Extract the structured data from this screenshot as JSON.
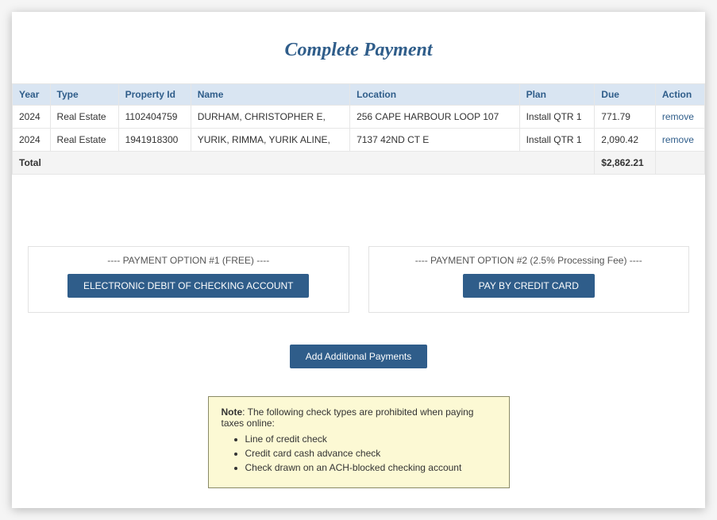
{
  "page": {
    "title": "Complete Payment"
  },
  "table": {
    "headers": {
      "year": "Year",
      "type": "Type",
      "property_id": "Property Id",
      "name": "Name",
      "location": "Location",
      "plan": "Plan",
      "due": "Due",
      "action": "Action"
    },
    "rows": [
      {
        "year": "2024",
        "type": "Real Estate",
        "property_id": "1102404759",
        "name": "DURHAM, CHRISTOPHER E,",
        "location": "256 CAPE HARBOUR LOOP 107",
        "plan": "Install QTR 1",
        "due": "771.79",
        "action": "remove"
      },
      {
        "year": "2024",
        "type": "Real Estate",
        "property_id": "1941918300",
        "name": "YURIK, RIMMA, YURIK ALINE,",
        "location": "7137 42ND CT E",
        "plan": "Install QTR 1",
        "due": "2,090.42",
        "action": "remove"
      }
    ],
    "total_label": "Total",
    "total_value": "$2,862.21"
  },
  "options": {
    "option1": {
      "title": "---- PAYMENT OPTION #1 (FREE) ----",
      "button": "ELECTRONIC DEBIT OF CHECKING ACCOUNT"
    },
    "option2": {
      "title": "---- PAYMENT OPTION #2 (2.5% Processing Fee) ----",
      "button": "PAY BY CREDIT CARD"
    }
  },
  "add_payments_button": "Add Additional Payments",
  "note": {
    "label": "Note",
    "intro": ": The following check types are prohibited when paying taxes online:",
    "items": [
      "Line of credit check",
      "Credit card cash advance check",
      "Check drawn on an ACH-blocked checking account"
    ]
  }
}
